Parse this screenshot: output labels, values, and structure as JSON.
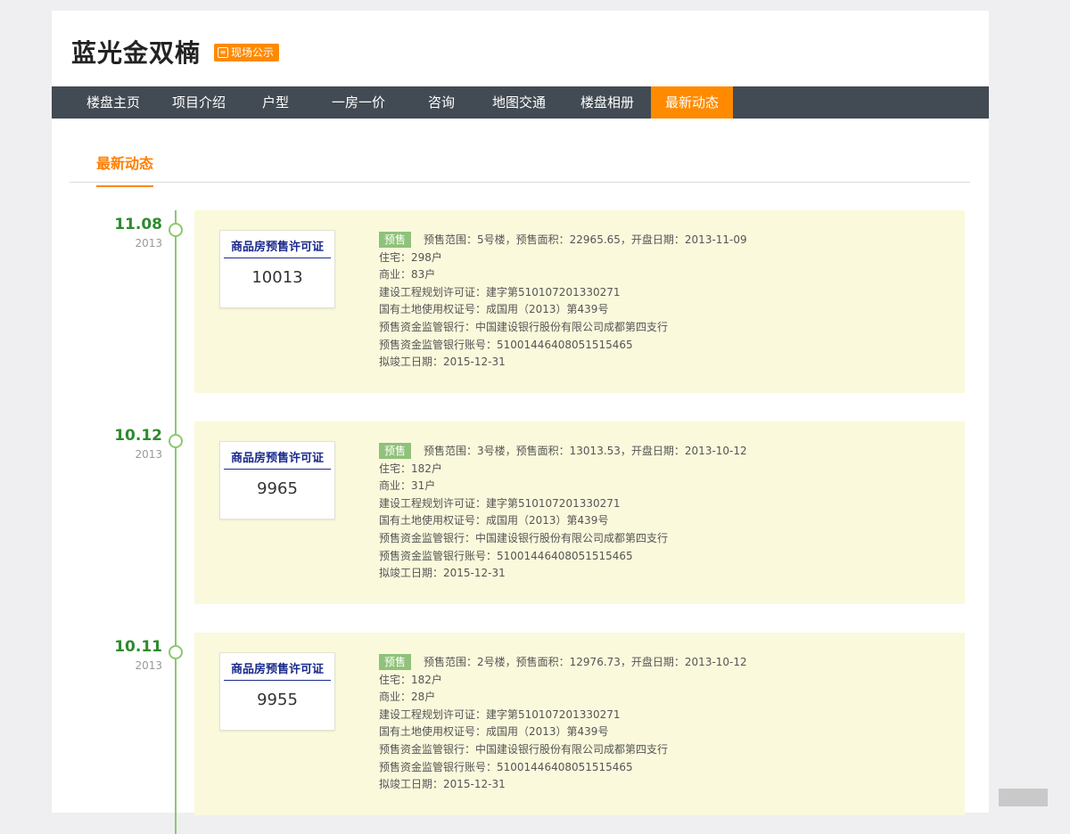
{
  "header": {
    "title": "蓝光金双楠",
    "badge": "现场公示"
  },
  "nav": [
    "楼盘主页",
    "项目介绍",
    "户型",
    "一房一价",
    "咨询",
    "地图交通",
    "楼盘相册",
    "最新动态"
  ],
  "nav_active": 7,
  "tab": "最新动态",
  "entries": [
    {
      "date": "11.08",
      "year": "2013",
      "cert_title": "商品房预售许可证",
      "cert_number": "10013",
      "tag": "预售",
      "summary": "预售范围：5号楼，预售面积：22965.65，开盘日期：2013-11-09",
      "lines": [
        "住宅：298户",
        "商业：83户",
        "建设工程规划许可证：建字第510107201330271",
        "国有土地使用权证号：成国用（2013）第439号",
        "预售资金监管银行：中国建设银行股份有限公司成都第四支行",
        "预售资金监管银行账号：51001446408051515465",
        "拟竣工日期：2015-12-31"
      ]
    },
    {
      "date": "10.12",
      "year": "2013",
      "cert_title": "商品房预售许可证",
      "cert_number": "9965",
      "tag": "预售",
      "summary": "预售范围：3号楼，预售面积：13013.53，开盘日期：2013-10-12",
      "lines": [
        "住宅：182户",
        "商业：31户",
        "建设工程规划许可证：建字第510107201330271",
        "国有土地使用权证号：成国用（2013）第439号",
        "预售资金监管银行：中国建设银行股份有限公司成都第四支行",
        "预售资金监管银行账号：51001446408051515465",
        "拟竣工日期：2015-12-31"
      ]
    },
    {
      "date": "10.11",
      "year": "2013",
      "cert_title": "商品房预售许可证",
      "cert_number": "9955",
      "tag": "预售",
      "summary": "预售范围：2号楼，预售面积：12976.73，开盘日期：2013-10-12",
      "lines": [
        "住宅：182户",
        "商业：28户",
        "建设工程规划许可证：建字第510107201330271",
        "国有土地使用权证号：成国用（2013）第439号",
        "预售资金监管银行：中国建设银行股份有限公司成都第四支行",
        "预售资金监管银行账号：51001446408051515465",
        "拟竣工日期：2015-12-31"
      ]
    }
  ],
  "colors": {
    "accent": "#ff8a00",
    "nav_bg": "#424a53",
    "timeline": "#8cc86e",
    "card_bg": "#fbf9dc",
    "tag": "#8fc27a",
    "date": "#2e8b2e"
  }
}
